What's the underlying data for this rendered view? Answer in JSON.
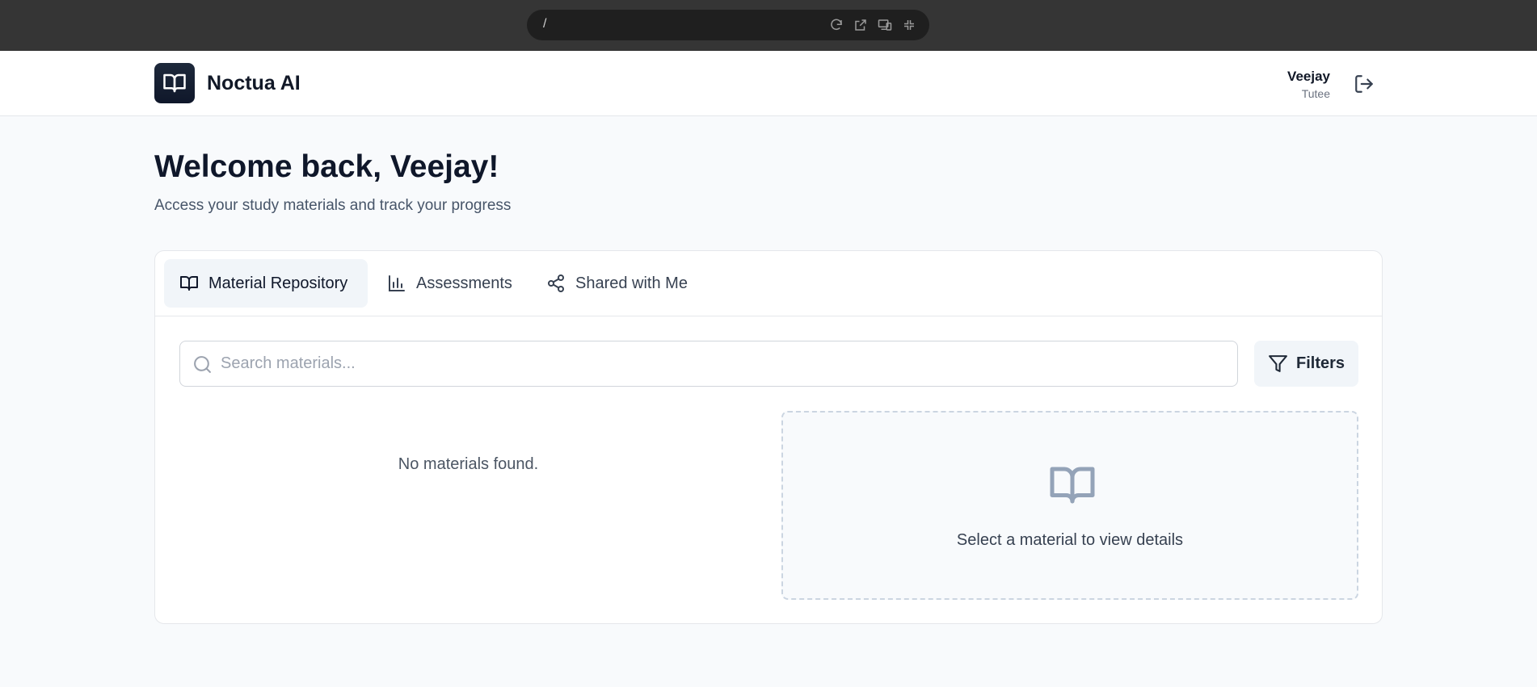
{
  "browser": {
    "url": "/"
  },
  "header": {
    "brand": "Noctua AI",
    "user_name": "Veejay",
    "user_role": "Tutee"
  },
  "welcome": {
    "title": "Welcome back, Veejay!",
    "subtitle": "Access your study materials and track your progress"
  },
  "tabs": [
    {
      "label": "Material Repository",
      "icon": "book-open-icon",
      "active": true
    },
    {
      "label": "Assessments",
      "icon": "bar-chart-icon",
      "active": false
    },
    {
      "label": "Shared with Me",
      "icon": "share-icon",
      "active": false
    }
  ],
  "search": {
    "placeholder": "Search materials...",
    "value": ""
  },
  "filters": {
    "label": "Filters"
  },
  "materials": {
    "empty_message": "No materials found."
  },
  "details": {
    "empty_message": "Select a material to view details"
  },
  "colors": {
    "logo_bg": "#0f172a",
    "active_tab_bg": "#f1f5f9",
    "page_bg": "#f8fafc",
    "dashed_border": "#cbd5e1"
  }
}
